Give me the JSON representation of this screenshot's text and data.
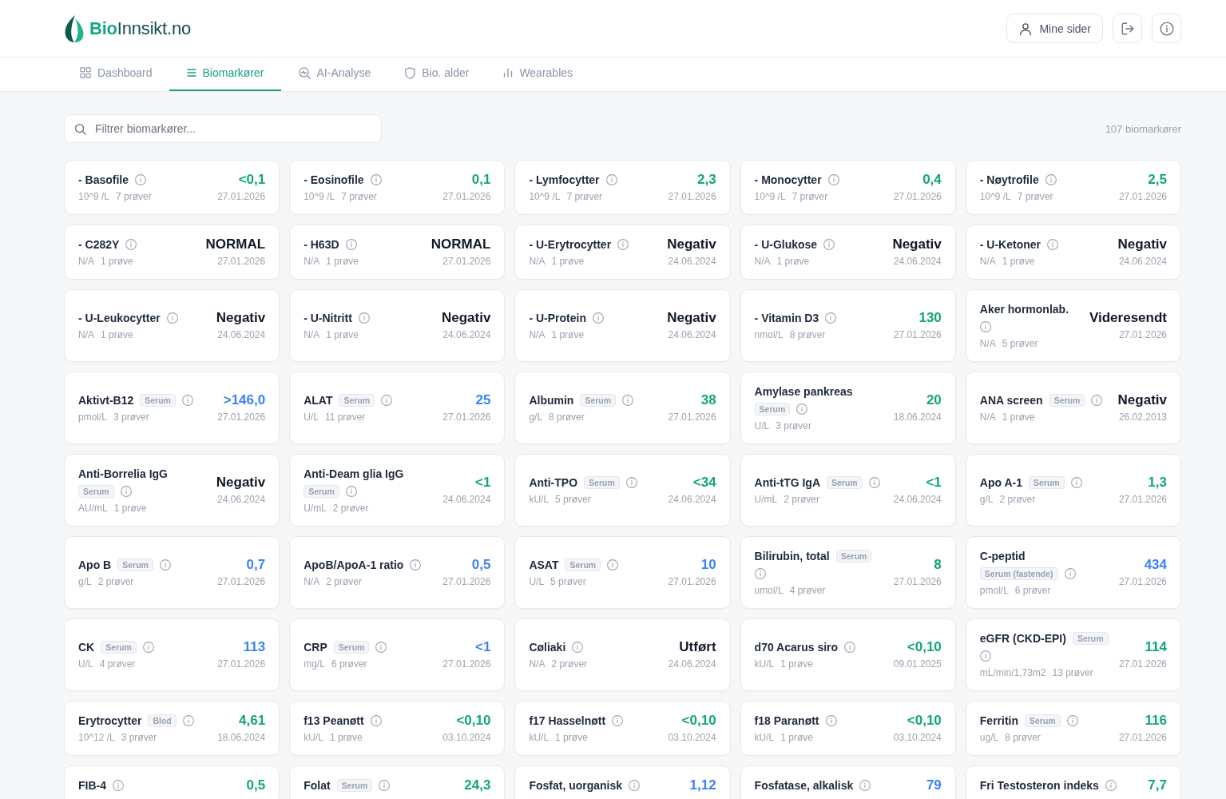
{
  "header": {
    "logo": "**Bio**Innsikt.no",
    "account_button": "Mine sider"
  },
  "tabs": [
    {
      "label": "Dashboard",
      "selected": false
    },
    {
      "label": "Biomarkører",
      "selected": true
    },
    {
      "label": "AI-Analyse",
      "selected": false
    },
    {
      "label": "Bio. alder",
      "selected": false
    },
    {
      "label": "Wearables",
      "selected": false
    }
  ],
  "filter": {
    "placeholder": "Filtrer biomarkører..."
  },
  "count": "107 biomarkører",
  "cards": [
    {
      "name": "- Basofile",
      "unit": "10^9 /L",
      "count": "7 prøver",
      "value": "<0,1",
      "color": "#10a874",
      "date": "27.01.2026"
    },
    {
      "name": "- Eosinofile",
      "unit": "10^9 /L",
      "count": "7 prøver",
      "value": "0,1",
      "color": "#10a874",
      "date": "27.01.2026"
    },
    {
      "name": "- Lymfocytter",
      "unit": "10^9 /L",
      "count": "7 prøver",
      "value": "2,3",
      "color": "#10a874",
      "date": "27.01.2026"
    },
    {
      "name": "- Monocytter",
      "unit": "10^9 /L",
      "count": "7 prøver",
      "value": "0,4",
      "color": "#10a874",
      "date": "27.01.2026"
    },
    {
      "name": "- Nøytrofile",
      "unit": "10^9 /L",
      "count": "7 prøver",
      "value": "2,5",
      "color": "#10a874",
      "date": "27.01.2026"
    },
    {
      "name": "- C282Y",
      "unit": "N/A",
      "count": "1 prøve",
      "value": "NORMAL",
      "color": "#111827",
      "date": "27.01.2026"
    },
    {
      "name": "- H63D",
      "unit": "N/A",
      "count": "1 prøve",
      "value": "NORMAL",
      "color": "#111827",
      "date": "27.01.2026"
    },
    {
      "name": "- U-Erytrocytter",
      "unit": "N/A",
      "count": "1 prøve",
      "value": "Negativ",
      "color": "#111827",
      "date": "24.06.2024"
    },
    {
      "name": "- U-Glukose",
      "unit": "N/A",
      "count": "1 prøve",
      "value": "Negativ",
      "color": "#111827",
      "date": "24.06.2024"
    },
    {
      "name": "- U-Ketoner",
      "unit": "N/A",
      "count": "1 prøve",
      "value": "Negativ",
      "color": "#111827",
      "date": "24.06.2024"
    },
    {
      "name": "- U-Leukocytter",
      "unit": "N/A",
      "count": "1 prøve",
      "value": "Negativ",
      "color": "#111827",
      "date": "24.06.2024"
    },
    {
      "name": "- U-Nitritt",
      "unit": "N/A",
      "count": "1 prøve",
      "value": "Negativ",
      "color": "#111827",
      "date": "24.06.2024"
    },
    {
      "name": "- U-Protein",
      "unit": "N/A",
      "count": "1 prøve",
      "value": "Negativ",
      "color": "#111827",
      "date": "24.06.2024"
    },
    {
      "name": "- Vitamin D3",
      "unit": "nmol/L",
      "count": "8 prøver",
      "value": "130",
      "color": "#10a874",
      "date": "27.01.2026"
    },
    {
      "name": "Aker hormonlab.",
      "unit": "N/A",
      "count": "5 prøver",
      "value": "Videresendt",
      "color": "#111827",
      "date": "27.01.2026"
    },
    {
      "name": "Aktivt-B12",
      "sample": "Serum",
      "unit": "pmol/L",
      "count": "3 prøver",
      "value": ">146,0",
      "color": "#3b82f6",
      "date": "27.01.2026"
    },
    {
      "name": "ALAT",
      "sample": "Serum",
      "unit": "U/L",
      "count": "11 prøver",
      "value": "25",
      "color": "#3b82f6",
      "date": "27.01.2026"
    },
    {
      "name": "Albumin",
      "sample": "Serum",
      "unit": "g/L",
      "count": "8 prøver",
      "value": "38",
      "color": "#10a874",
      "date": "27.01.2026"
    },
    {
      "name": "Amylase pankreas",
      "sample": "Serum",
      "unit": "U/L",
      "count": "3 prøver",
      "value": "20",
      "color": "#10a874",
      "date": "18.06.2024"
    },
    {
      "name": "ANA screen",
      "sample": "Serum",
      "unit": "N/A",
      "count": "1 prøve",
      "value": "Negativ",
      "color": "#111827",
      "date": "26.02.2013"
    },
    {
      "name": "Anti-Borrelia IgG",
      "sample": "Serum",
      "unit": "AU/mL",
      "count": "1 prøve",
      "value": "Negativ",
      "color": "#111827",
      "date": "24.06.2024"
    },
    {
      "name": "Anti-Deam glia IgG",
      "sample": "Serum",
      "unit": "U/mL",
      "count": "2 prøver",
      "value": "<1",
      "color": "#10a874",
      "date": "24.06.2024"
    },
    {
      "name": "Anti-TPO",
      "sample": "Serum",
      "unit": "kU/L",
      "count": "5 prøver",
      "value": "<34",
      "color": "#10a874",
      "date": "24.06.2024"
    },
    {
      "name": "Anti-tTG IgA",
      "sample": "Serum",
      "unit": "U/mL",
      "count": "2 prøver",
      "value": "<1",
      "color": "#10a874",
      "date": "24.06.2024"
    },
    {
      "name": "Apo A-1",
      "sample": "Serum",
      "unit": "g/L",
      "count": "2 prøver",
      "value": "1,3",
      "color": "#10a874",
      "date": "27.01.2026"
    },
    {
      "name": "Apo B",
      "sample": "Serum",
      "unit": "g/L",
      "count": "2 prøver",
      "value": "0,7",
      "color": "#3b82f6",
      "date": "27.01.2026"
    },
    {
      "name": "ApoB/ApoA-1 ratio",
      "unit": "N/A",
      "count": "2 prøver",
      "value": "0,5",
      "color": "#3b82f6",
      "date": "27.01.2026"
    },
    {
      "name": "ASAT",
      "sample": "Serum",
      "unit": "U/L",
      "count": "5 prøver",
      "value": "10",
      "color": "#3b82f6",
      "date": "27.01.2026"
    },
    {
      "name": "Bilirubin, total",
      "sample": "Serum",
      "unit": "umol/L",
      "count": "4 prøver",
      "value": "8",
      "color": "#10a874",
      "date": "27.01.2026"
    },
    {
      "name": "C-peptid",
      "sample": "Serum (fastende)",
      "unit": "pmol/L",
      "count": "6 prøver",
      "value": "434",
      "color": "#3b82f6",
      "date": "27.01.2026"
    },
    {
      "name": "CK",
      "sample": "Serum",
      "unit": "U/L",
      "count": "4 prøver",
      "value": "113",
      "color": "#3b82f6",
      "date": "27.01.2026"
    },
    {
      "name": "CRP",
      "sample": "Serum",
      "unit": "mg/L",
      "count": "6 prøver",
      "value": "<1",
      "color": "#3b82f6",
      "date": "27.01.2026"
    },
    {
      "name": "Cøliaki",
      "unit": "N/A",
      "count": "2 prøver",
      "value": "Utført",
      "color": "#111827",
      "date": "24.06.2024"
    },
    {
      "name": "d70 Acarus siro",
      "unit": "kU/L",
      "count": "1 prøve",
      "value": "<0,10",
      "color": "#10a874",
      "date": "09.01.2025"
    },
    {
      "name": "eGFR (CKD-EPI)",
      "sample": "Serum",
      "unit": "mL/min/1,73m2",
      "count": "13 prøver",
      "value": "114",
      "color": "#10a874",
      "date": "27.01.2026"
    },
    {
      "name": "Erytrocytter",
      "sample": "Blod",
      "unit": "10^12 /L",
      "count": "3 prøver",
      "value": "4,61",
      "color": "#10a874",
      "date": "18.06.2024"
    },
    {
      "name": "f13 Peanøtt",
      "unit": "kU/L",
      "count": "1 prøve",
      "value": "<0,10",
      "color": "#10a874",
      "date": "03.10.2024"
    },
    {
      "name": "f17 Hasselnøtt",
      "unit": "kU/L",
      "count": "1 prøve",
      "value": "<0,10",
      "color": "#10a874",
      "date": "03.10.2024"
    },
    {
      "name": "f18 Paranøtt",
      "unit": "kU/L",
      "count": "1 prøve",
      "value": "<0,10",
      "color": "#10a874",
      "date": "03.10.2024"
    },
    {
      "name": "Ferritin",
      "sample": "Serum",
      "unit": "ug/L",
      "count": "8 prøver",
      "value": "116",
      "color": "#10a874",
      "date": "27.01.2026"
    },
    {
      "name": "FIB-4",
      "value": "0,5",
      "color": "#10a874"
    },
    {
      "name": "Folat",
      "sample": "Serum",
      "value": "24,3",
      "color": "#10a874"
    },
    {
      "name": "Fosfat, uorganisk",
      "value": "1,12",
      "color": "#3b82f6"
    },
    {
      "name": "Fosfatase, alkalisk",
      "value": "79",
      "color": "#3b82f6"
    },
    {
      "name": "Fri Testosteron indeks",
      "value": "7,7",
      "color": "#10a874"
    }
  ]
}
